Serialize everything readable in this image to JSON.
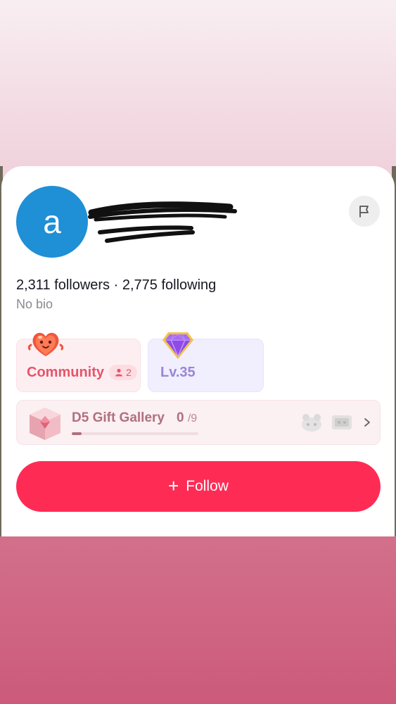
{
  "profile": {
    "avatar_letter": "a",
    "followers_count": "2,311",
    "followers_label": "followers",
    "separator": "·",
    "following_count": "2,775",
    "following_label": "following",
    "bio": "No bio"
  },
  "cards": {
    "community_label": "Community",
    "community_members": "2",
    "level_label": "Lv.35"
  },
  "gallery": {
    "title": "D5 Gift Gallery",
    "collected": "0",
    "total": "/9",
    "progress_fraction": 0.08
  },
  "actions": {
    "follow_plus": "+",
    "follow_label": "Follow"
  },
  "colors": {
    "follow_button": "#fe2c55",
    "avatar": "#1f8fd6",
    "community_accent": "#e8536b",
    "level_accent": "#9a86d4"
  },
  "icons": [
    "report-flag-icon",
    "heart-mascot-icon",
    "diamond-icon",
    "gift-box-icon",
    "chevron-right-icon",
    "person-icon"
  ]
}
